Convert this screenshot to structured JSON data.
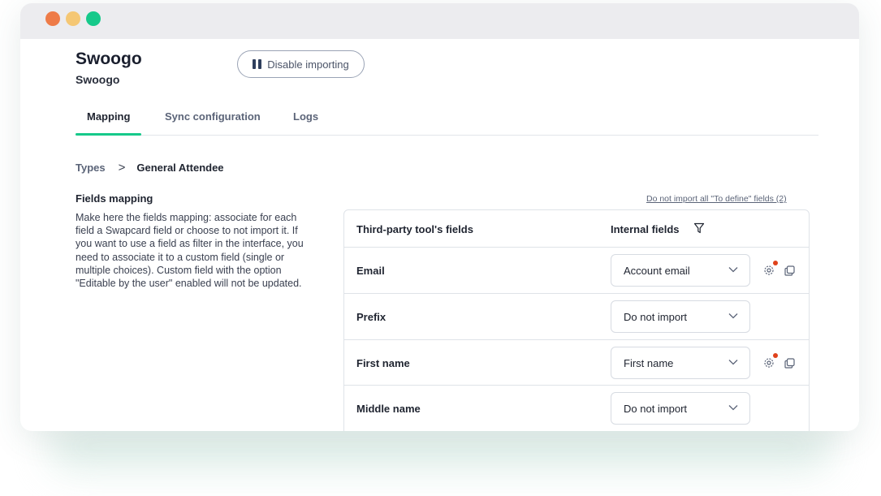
{
  "window": {
    "controls": [
      "close",
      "minimize",
      "maximize"
    ]
  },
  "header": {
    "title": "Swoogo",
    "subtitle": "Swoogo",
    "disable_button": "Disable importing"
  },
  "tabs": [
    {
      "label": "Mapping",
      "active": true
    },
    {
      "label": "Sync configuration",
      "active": false
    },
    {
      "label": "Logs",
      "active": false
    }
  ],
  "breadcrumb": {
    "root": "Types",
    "separator": ">",
    "current": "General Attendee"
  },
  "fields_mapping": {
    "title": "Fields mapping",
    "description": "Make here the fields mapping: associate for each field a Swapcard field or choose to not import it. If you want to use a field as filter in the interface, you need to associate it to a custom field (single or multiple choices). Custom field with the option \"Editable by the user\" enabled will not be updated.",
    "link": "Do not import all \"To define\" fields (2)"
  },
  "table": {
    "headers": {
      "third_party": "Third-party tool's fields",
      "internal": "Internal fields"
    },
    "rows": [
      {
        "field": "Email",
        "internal": "Account email",
        "has_settings": true
      },
      {
        "field": "Prefix",
        "internal": "Do not import",
        "has_settings": false
      },
      {
        "field": "First name",
        "internal": "First name",
        "has_settings": true
      },
      {
        "field": "Middle name",
        "internal": "Do not import",
        "has_settings": false
      }
    ]
  },
  "colors": {
    "accent": "#16c98a",
    "badge": "#e0421b",
    "close": "#ee7b48",
    "minimize": "#f5c774",
    "maximize": "#16c98a"
  }
}
